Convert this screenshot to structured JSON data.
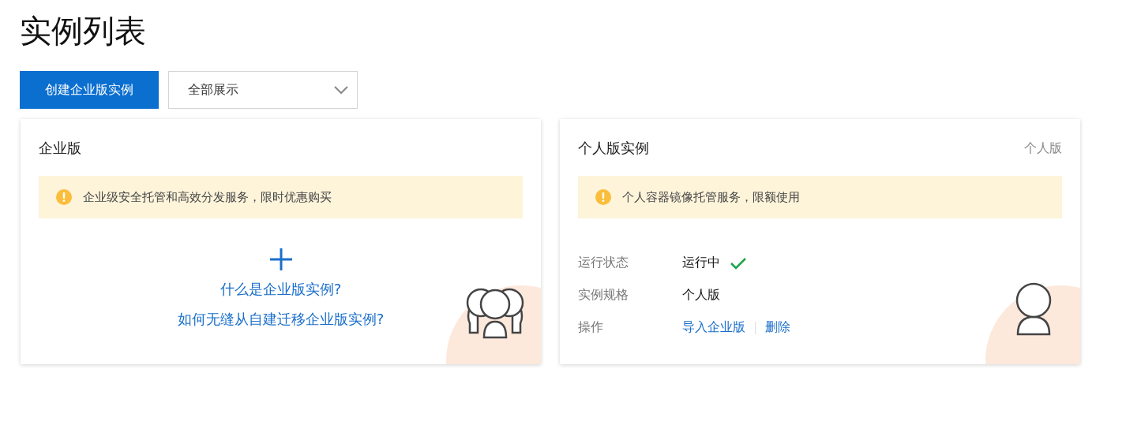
{
  "page_title": "实例列表",
  "toolbar": {
    "create_button": "创建企业版实例",
    "filter": {
      "value": "全部展示"
    }
  },
  "cards": [
    {
      "kind": "enterprise",
      "title": "企业版",
      "notice": "企业级安全托管和高效分发服务，限时优惠购买",
      "links": [
        "什么是企业版实例?",
        "如何无缝从自建迁移企业版实例?"
      ]
    },
    {
      "kind": "personal",
      "title": "个人版实例",
      "tag": "个人版",
      "notice": "个人容器镜像托管服务，限额使用",
      "fields": [
        {
          "kind": "status",
          "label": "运行状态",
          "value": "运行中"
        },
        {
          "kind": "text",
          "label": "实例规格",
          "value": "个人版"
        },
        {
          "kind": "actions",
          "label": "操作",
          "actions": [
            "导入企业版",
            "删除"
          ]
        }
      ]
    }
  ]
}
